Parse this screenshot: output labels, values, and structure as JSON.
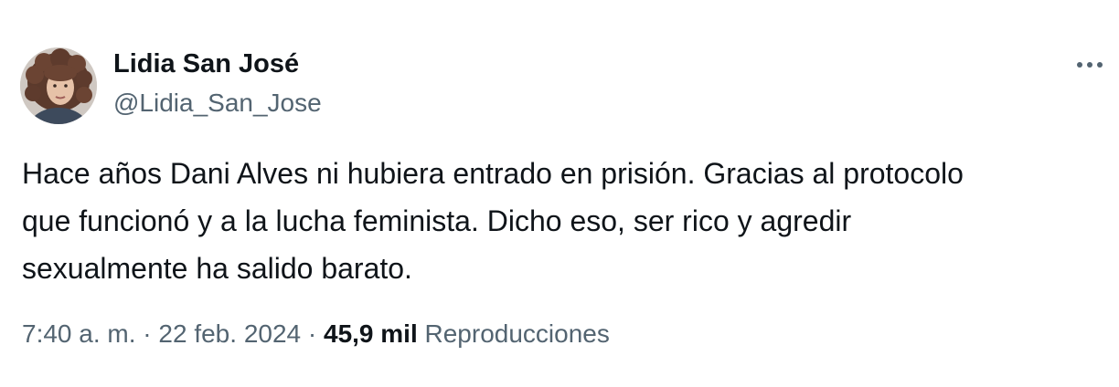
{
  "author": {
    "name": "Lidia San José",
    "handle": "@Lidia_San_Jose"
  },
  "more_icon": "more-horizontal-icon",
  "tweet": {
    "lines": [
      "Hace años Dani Alves ni hubiera entrado en prisión. Gracias al protocolo",
      "que funcionó y a la lucha feminista. Dicho eso, ser rico y agredir",
      "sexualmente ha salido barato."
    ]
  },
  "meta": {
    "time": "7:40 a. m.",
    "separator": "·",
    "date": "22 feb. 2024",
    "views_count": "45,9 mil",
    "views_label": "Reproducciones"
  },
  "colors": {
    "text_primary": "#0f1419",
    "text_secondary": "#536471",
    "background": "#ffffff"
  }
}
